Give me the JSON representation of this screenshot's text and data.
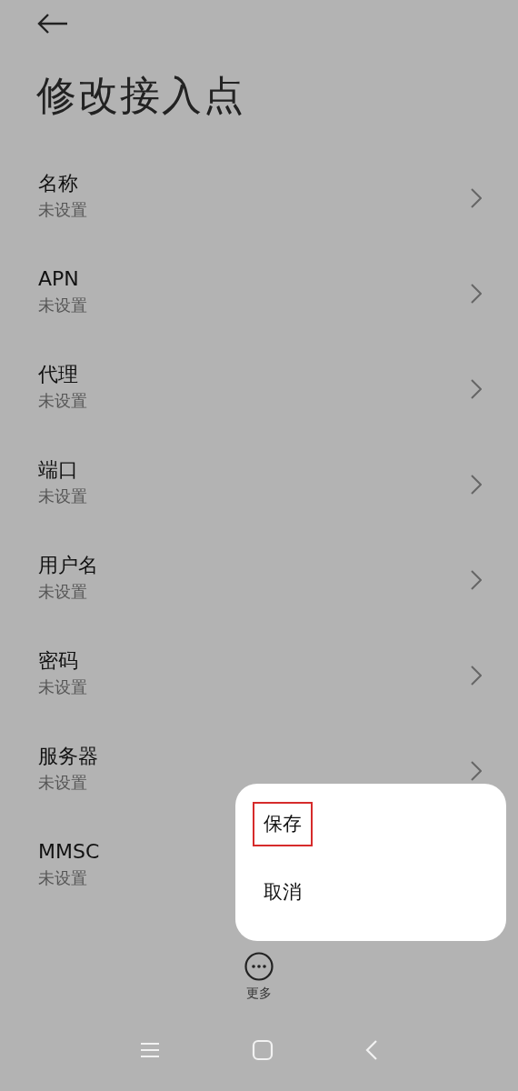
{
  "title": "修改接入点",
  "items": [
    {
      "label": "名称",
      "value": "未设置"
    },
    {
      "label": "APN",
      "value": "未设置"
    },
    {
      "label": "代理",
      "value": "未设置"
    },
    {
      "label": "端口",
      "value": "未设置"
    },
    {
      "label": "用户名",
      "value": "未设置"
    },
    {
      "label": "密码",
      "value": "未设置"
    },
    {
      "label": "服务器",
      "value": "未设置"
    }
  ],
  "item_under_menu": {
    "label": "MMSC",
    "value": "未设置"
  },
  "popup_menu": [
    {
      "label": "保存",
      "highlighted": true
    },
    {
      "label": "取消",
      "highlighted": false
    }
  ],
  "more_button": {
    "label": "更多"
  }
}
